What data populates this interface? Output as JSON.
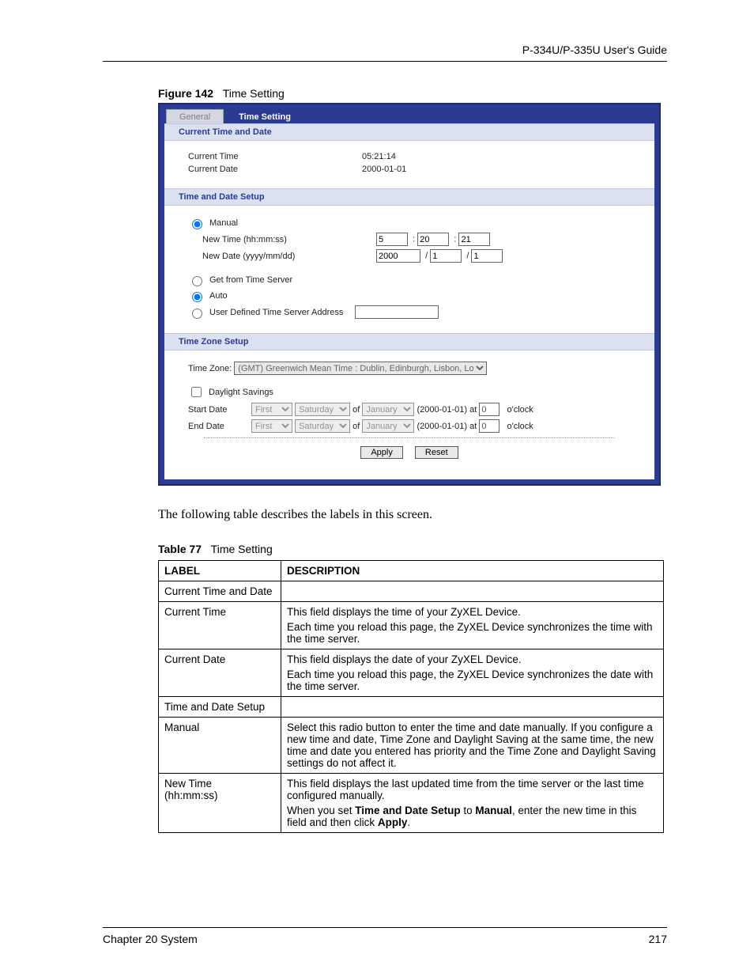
{
  "doc": {
    "running_header": "P-334U/P-335U User's Guide",
    "figure_label": "Figure 142",
    "figure_title": "Time Setting",
    "body_para": "The following table describes the labels in this screen.",
    "table_label": "Table 77",
    "table_title": "Time Setting",
    "footer_chapter": "Chapter 20 System",
    "footer_page": "217"
  },
  "shot": {
    "tabs": {
      "general": "General",
      "time_setting": "Time Setting"
    },
    "sec1": {
      "title": "Current Time and Date",
      "current_time_label": "Current Time",
      "current_time_value": "05:21:14",
      "current_date_label": "Current Date",
      "current_date_value": "2000-01-01"
    },
    "sec2": {
      "title": "Time and Date Setup",
      "manual_label": "Manual",
      "new_time_label": "New Time (hh:mm:ss)",
      "new_time_h": "5",
      "new_time_m": "20",
      "new_time_s": "21",
      "new_date_label": "New Date (yyyy/mm/dd)",
      "new_date_y": "2000",
      "new_date_m": "1",
      "new_date_d": "1",
      "ts_label": "Get from Time Server",
      "auto_label": "Auto",
      "user_def_label": "User Defined Time Server Address",
      "user_def_value": ""
    },
    "sec3": {
      "title": "Time Zone Setup",
      "tz_label": "Time Zone:",
      "tz_value": "(GMT) Greenwich Mean Time : Dublin, Edinburgh, Lisbon, London",
      "ds_label": "Daylight Savings",
      "start_label": "Start Date",
      "end_label": "End Date",
      "week_opt": "First",
      "day_opt": "Saturday",
      "month_opt": "January",
      "of_text": "of",
      "paren_date": "(2000-01-01)  at",
      "hour_val": "0",
      "oclock": "o'clock"
    },
    "buttons": {
      "apply": "Apply",
      "reset": "Reset"
    }
  },
  "table": {
    "col_label": "LABEL",
    "col_desc": "DESCRIPTION",
    "rows": [
      {
        "label": "Current Time and Date",
        "desc": [
          ""
        ]
      },
      {
        "label": "Current Time",
        "desc": [
          "This field displays the time of your ZyXEL Device.",
          "Each time you reload this page, the ZyXEL Device synchronizes the time with the time server."
        ]
      },
      {
        "label": "Current Date",
        "desc": [
          "This field displays the date of your ZyXEL Device.",
          "Each time you reload this page, the ZyXEL Device synchronizes the date with the time server."
        ]
      },
      {
        "label": "Time and Date Setup",
        "desc": [
          ""
        ]
      },
      {
        "label": "Manual",
        "desc": [
          "Select this radio button to enter the time and date manually. If you configure a new time and date, Time Zone and Daylight Saving at the same time, the new time and date you entered has priority and the Time Zone and Daylight Saving settings do not affect it."
        ]
      },
      {
        "label_html": "New Time<br>(hh:mm:ss)",
        "desc_html": [
          "This field displays the last updated time from the time server or the last time configured manually.",
          "When you set <b>Time and Date Setup</b> to <b>Manual</b>, enter the new time in this field and then click <b>Apply</b>."
        ]
      }
    ]
  }
}
